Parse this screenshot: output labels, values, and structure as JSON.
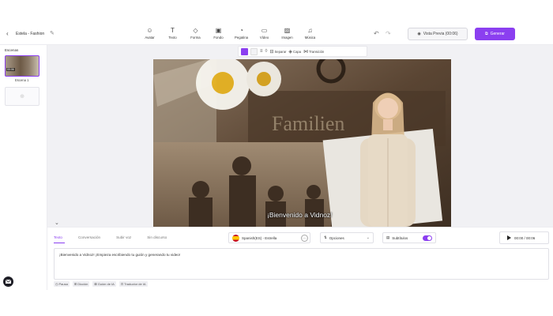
{
  "header": {
    "back_icon": "chevron-left-icon",
    "title": "Estela - Fashion",
    "edit_icon": "pencil-icon",
    "tools": [
      {
        "label": "Avatar",
        "icon": "avatar-icon"
      },
      {
        "label": "Texto",
        "icon": "text-icon"
      },
      {
        "label": "Forma",
        "icon": "shapes-icon"
      },
      {
        "label": "Fondo",
        "icon": "image-frame-icon"
      },
      {
        "label": "Pegatina",
        "icon": "sticker-icon"
      },
      {
        "label": "Vídeo",
        "icon": "video-icon"
      },
      {
        "label": "Imagen",
        "icon": "image-icon"
      },
      {
        "label": "Música",
        "icon": "music-icon"
      }
    ],
    "undo_icon": "undo-icon",
    "redo_icon": "redo-icon",
    "preview_label": "Vista Previa (00:06)",
    "generate_label": "Generar"
  },
  "sidebar": {
    "scenes_label": "Escenas",
    "scene_time": "00:06",
    "scene_name": "Escena 1",
    "add_icon": "plus-icon"
  },
  "canvas_toolbar": {
    "separate_label": "Separar",
    "layer_label": "Capa",
    "transition_label": "Transición"
  },
  "canvas": {
    "caption": "¡Bienvenido a Vidnoz!"
  },
  "editor": {
    "tabs": [
      "Texto",
      "Conversación",
      "Subir voz",
      "Sin discurso"
    ],
    "active_tab": "Texto",
    "voice_label": "Spanish(ES) - Estrella",
    "options_label": "Opciones",
    "subtitles_label": "Subtítulos",
    "subtitles_on": true,
    "playback_time": "00:00 / 00:06",
    "script_text": "¡Bienvenido a Vidnoz! ¡Empieza escribiendo tu guión y generando tu video!",
    "chips": [
      "Pausa",
      "Dicción",
      "Guión de IA",
      "Traductor de IA"
    ]
  },
  "colors": {
    "accent": "#8b3ff0"
  }
}
